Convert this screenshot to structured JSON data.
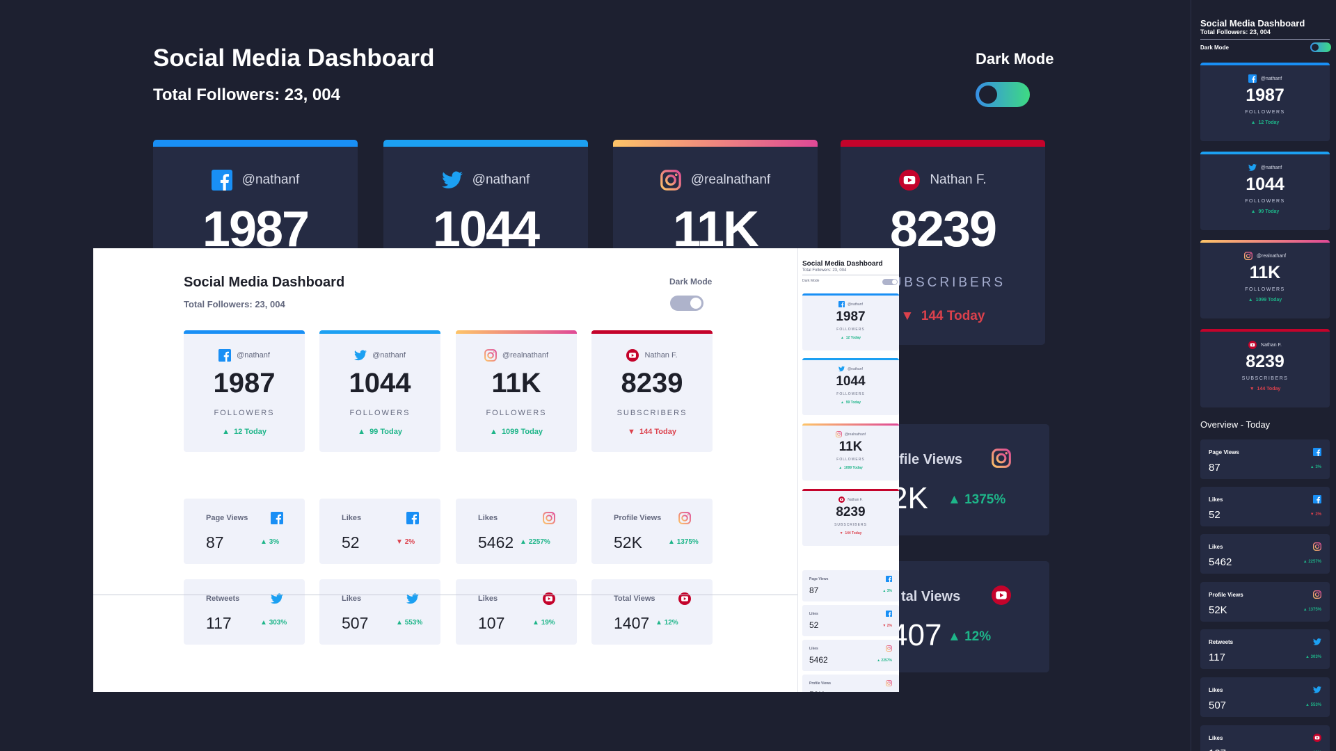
{
  "title": "Social Media Dashboard",
  "total_followers": "Total Followers: 23, 004",
  "dark_mode_label": "Dark Mode",
  "overview_title": "Overview - Today",
  "colors": {
    "facebook": "#198ff5",
    "twitter": "#1ca0f2",
    "instagram_start": "#fdc468",
    "instagram_end": "#df4996",
    "youtube": "#c4032b",
    "up": "#1eb589",
    "down": "#dc414c",
    "dark_bg": "#1d2030",
    "dark_card": "#252b43",
    "light_card": "#f0f2fa"
  },
  "main_cards": [
    {
      "network": "facebook",
      "icon": "facebook-icon",
      "handle": "@nathanf",
      "count": "1987",
      "label": "FOLLOWERS",
      "change": "12 Today",
      "direction": "up"
    },
    {
      "network": "twitter",
      "icon": "twitter-icon",
      "handle": "@nathanf",
      "count": "1044",
      "label": "FOLLOWERS",
      "change": "99 Today",
      "direction": "up"
    },
    {
      "network": "instagram",
      "icon": "instagram-icon",
      "handle": "@realnathanf",
      "count": "11K",
      "label": "FOLLOWERS",
      "change": "1099 Today",
      "direction": "up"
    },
    {
      "network": "youtube",
      "icon": "youtube-icon",
      "handle": "Nathan F.",
      "count": "8239",
      "label": "SUBSCRIBERS",
      "change": "144 Today",
      "direction": "down"
    }
  ],
  "overview": [
    {
      "title": "Page Views",
      "network": "facebook",
      "value": "87",
      "change": "3%",
      "direction": "up"
    },
    {
      "title": "Likes",
      "network": "facebook",
      "value": "52",
      "change": "2%",
      "direction": "down"
    },
    {
      "title": "Likes",
      "network": "instagram",
      "value": "5462",
      "change": "2257%",
      "direction": "up"
    },
    {
      "title": "Profile Views",
      "network": "instagram",
      "value": "52K",
      "change": "1375%",
      "direction": "up"
    },
    {
      "title": "Retweets",
      "network": "twitter",
      "value": "117",
      "change": "303%",
      "direction": "up"
    },
    {
      "title": "Likes",
      "network": "twitter",
      "value": "507",
      "change": "553%",
      "direction": "up"
    },
    {
      "title": "Likes",
      "network": "youtube",
      "value": "107",
      "change": "19%",
      "direction": "up"
    },
    {
      "title": "Total Views",
      "network": "youtube",
      "value": "1407",
      "change": "12%",
      "direction": "up"
    }
  ],
  "dark_partial_overview": [
    {
      "title_fragment": "ofile Views",
      "value_fragment": "2K",
      "change": "1375%",
      "network": "instagram"
    },
    {
      "title_fragment": "tal Views",
      "value_fragment": "407",
      "change": "12%",
      "network": "youtube"
    }
  ]
}
